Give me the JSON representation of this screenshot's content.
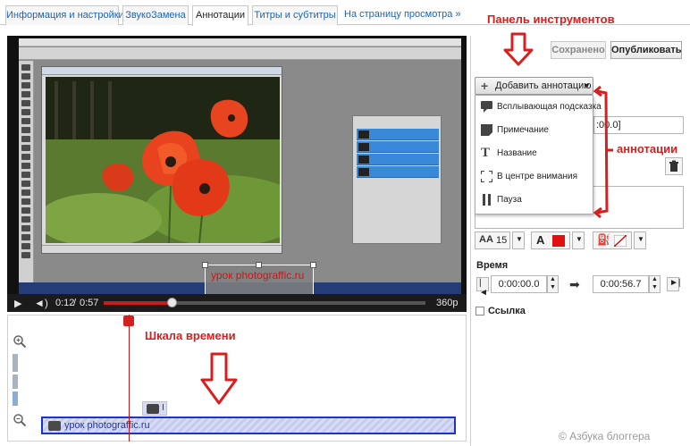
{
  "tabs": [
    {
      "label": "Информация и настройки",
      "active": false
    },
    {
      "label": "ЗвукоЗамена",
      "active": false
    },
    {
      "label": "Аннотации",
      "active": true
    },
    {
      "label": "Титры и субтитры",
      "active": false
    }
  ],
  "view_page_link": "На страницу просмотра »",
  "video": {
    "current_time": "0:12",
    "separator": "/",
    "duration": "0:57",
    "quality": "360p",
    "progress": 0.21,
    "annotation_text": "урок photograffic.ru"
  },
  "toolbar": {
    "saved_label": "Сохранено",
    "publish_label": "Опубликовать",
    "add_annotation_label": "Добавить аннотацию"
  },
  "annotation_menu": [
    {
      "icon": "speech-bubble-icon",
      "label": "Всплывающая подсказка"
    },
    {
      "icon": "note-icon",
      "label": "Примечание"
    },
    {
      "icon": "title-icon",
      "label": "Название"
    },
    {
      "icon": "spotlight-icon",
      "label": "В центре внимания"
    },
    {
      "icon": "pause-icon",
      "label": "Пауза"
    }
  ],
  "editor": {
    "partial_time_value": ":00.0]",
    "font_size": "15",
    "time_label": "Время",
    "start_time": "0:00:00.0",
    "end_time": "0:00:56.7",
    "link_label": "Ссылка",
    "text_color": "#e01010"
  },
  "timeline": {
    "track_label": "урок photograffic.ru",
    "small_track_label": "I"
  },
  "callouts": {
    "toolbar": "Панель инструментов",
    "annotations": "аннотации",
    "timeline": "Шкала времени"
  },
  "watermark": "© Азбука блоггера",
  "colors": {
    "accent_red": "#d81e1e",
    "link_blue": "#1c62b9",
    "track_blue": "#1d34c8"
  }
}
